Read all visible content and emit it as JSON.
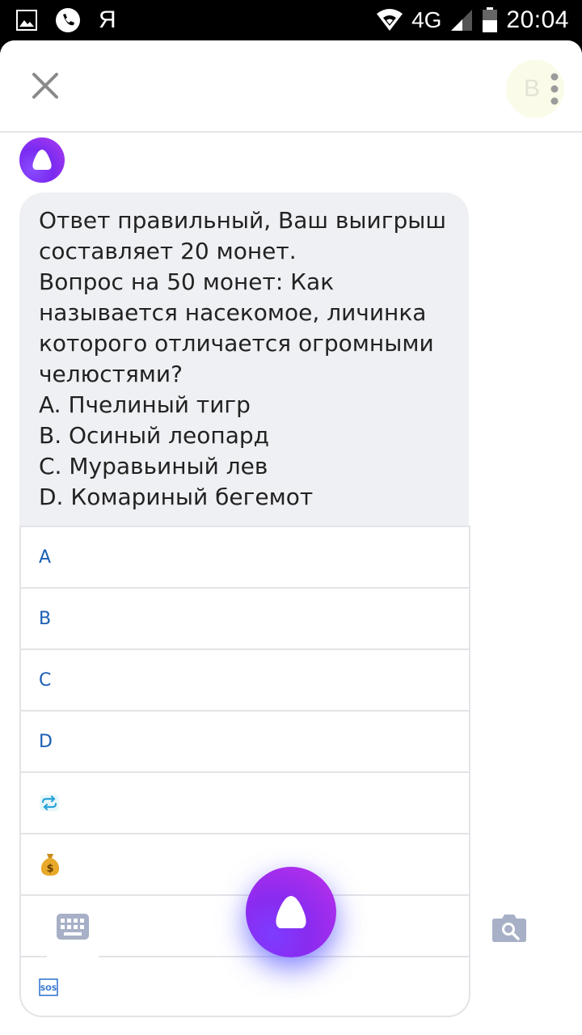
{
  "status_bar": {
    "time": "20:04",
    "network": "4G",
    "app_letter": "Я",
    "icons": [
      "image-icon",
      "phone-icon",
      "wifi-icon",
      "signal-icon",
      "battery-icon"
    ]
  },
  "header": {
    "profile_letter": "В"
  },
  "message": {
    "lines": [
      "Ответ правильный, Ваш выигрыш",
      "составляет 20 монет.",
      "Вопрос на 50 монет: Как",
      "называется насекомое, личинка",
      "которого отличается огромными",
      "челюстями?",
      "A. Пчелиный тигр",
      "B. Осиный леопард",
      "C. Муравьиный лев",
      "D. Комариный бегемот"
    ]
  },
  "buttons": [
    {
      "label": "A"
    },
    {
      "label": "B"
    },
    {
      "label": "C"
    },
    {
      "label": "D"
    },
    {
      "label": "",
      "icon": "repeat-icon"
    },
    {
      "label": "",
      "icon": "money-bag-icon"
    },
    {
      "label": "",
      "icon": "blank"
    },
    {
      "label": "",
      "icon": "sos-icon"
    }
  ],
  "colors": {
    "accent_purple": "#8a2bf0",
    "button_text": "#1a5fb4",
    "bubble_bg": "#eff0f3"
  }
}
